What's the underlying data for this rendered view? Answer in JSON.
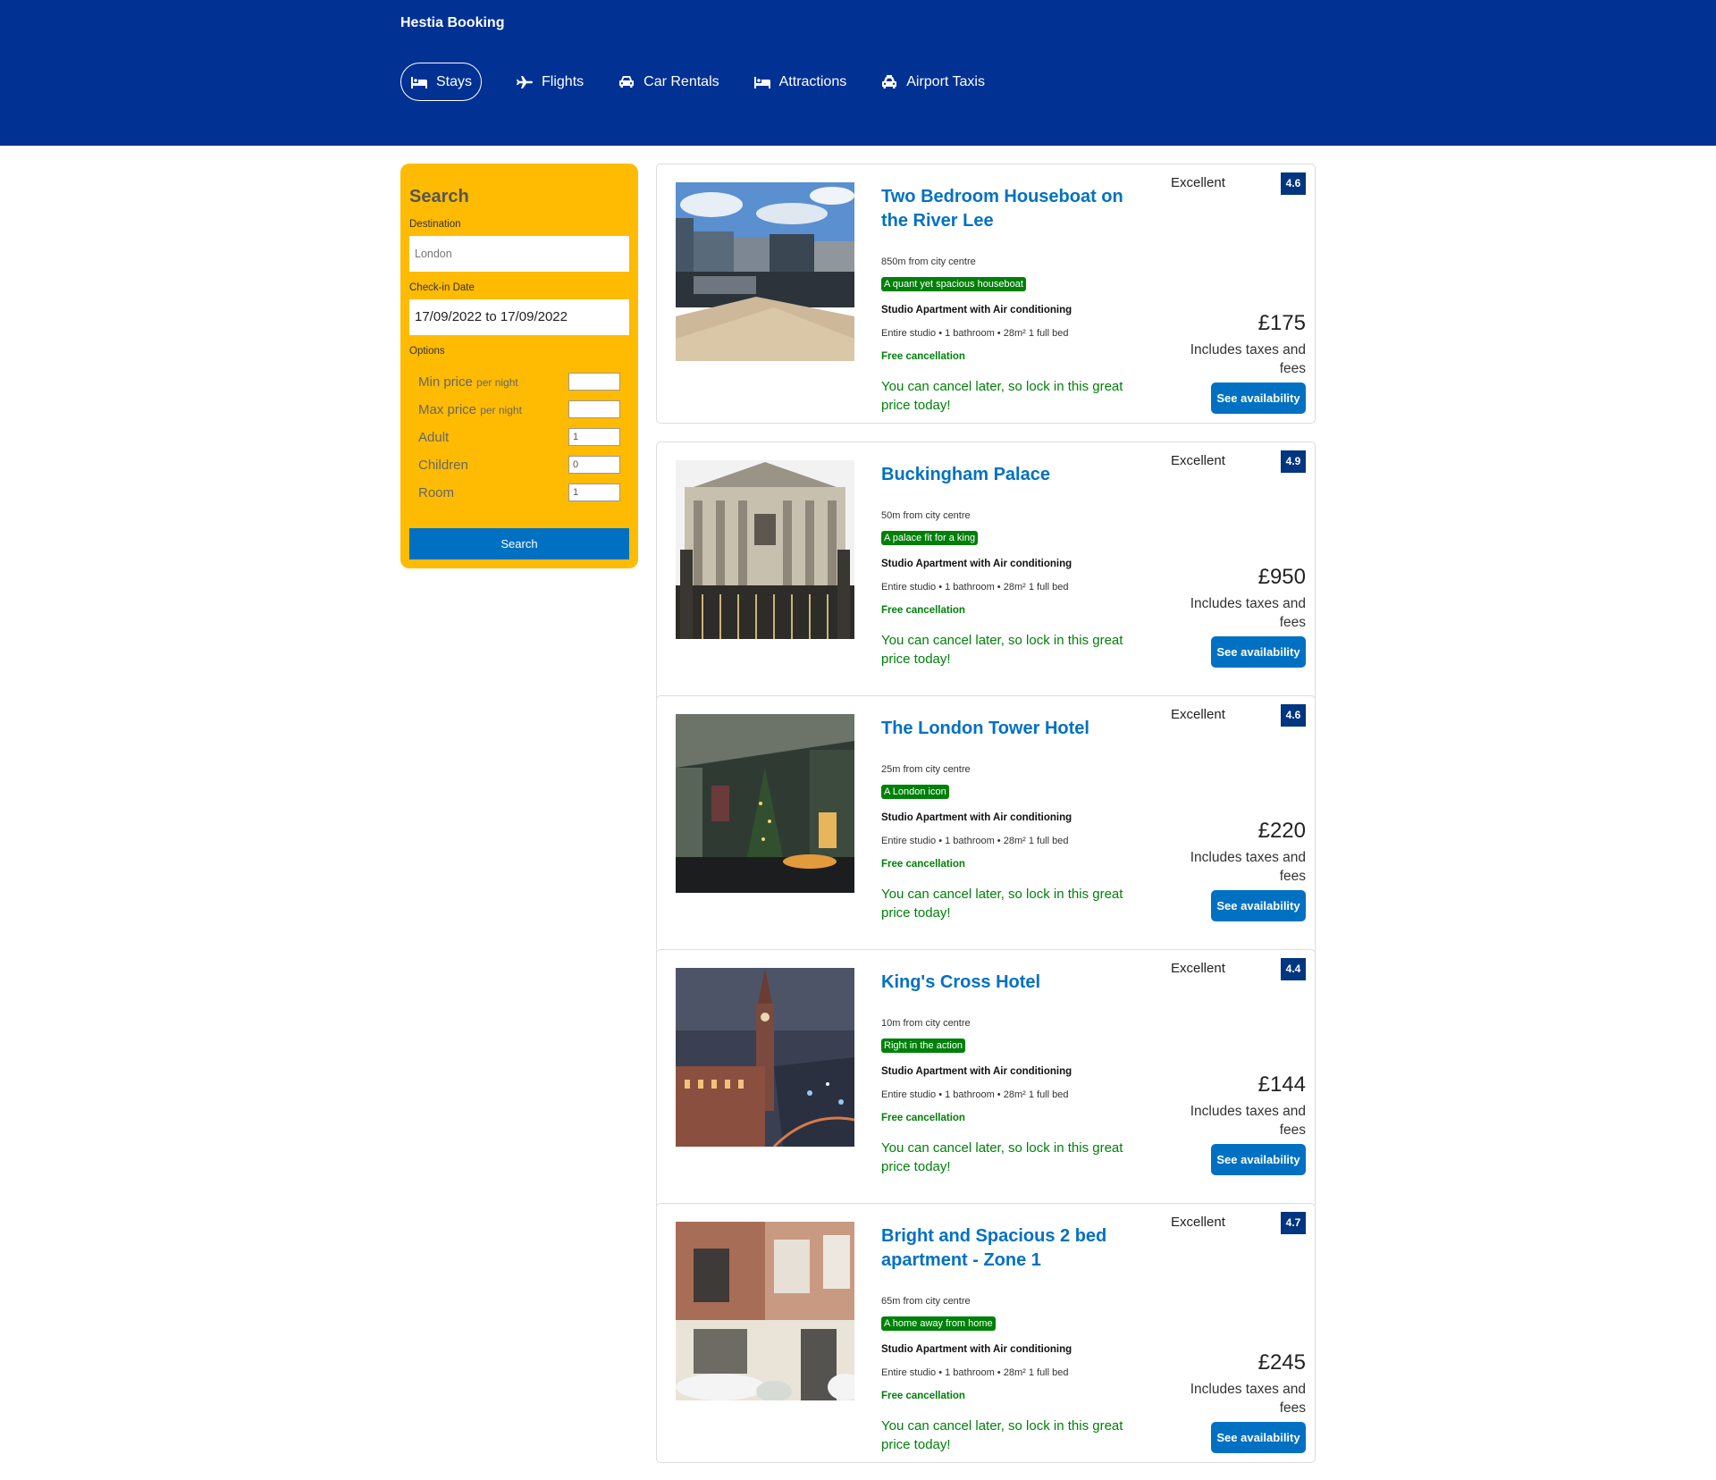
{
  "header": {
    "brand": "Hestia Booking",
    "nav": [
      {
        "label": "Stays",
        "icon": "bed-icon",
        "active": true
      },
      {
        "label": "Flights",
        "icon": "plane-icon"
      },
      {
        "label": "Car Rentals",
        "icon": "car-icon"
      },
      {
        "label": "Attractions",
        "icon": "bed-icon"
      },
      {
        "label": "Airport Taxis",
        "icon": "taxi-icon"
      }
    ]
  },
  "search": {
    "title": "Search",
    "destination_label": "Destination",
    "destination_placeholder": "London",
    "checkin_label": "Check-in Date",
    "checkin_value": "17/09/2022 to 17/09/2022",
    "options_label": "Options",
    "options": [
      {
        "label": "Min price",
        "suffix": "per night",
        "value": ""
      },
      {
        "label": "Max price",
        "suffix": "per night",
        "value": ""
      },
      {
        "label": "Adult",
        "suffix": "",
        "value": "1"
      },
      {
        "label": "Children",
        "suffix": "",
        "value": "0"
      },
      {
        "label": "Room",
        "suffix": "",
        "value": "1"
      }
    ],
    "button": "Search"
  },
  "results": [
    {
      "title": "Two Bedroom Houseboat on the River Lee",
      "distance": "850m from city centre",
      "taxi": "A quant yet spacious houseboat",
      "subtitle": "Studio Apartment with Air conditioning",
      "features": "Entire studio • 1 bathroom • 28m² 1 full bed",
      "cancel": "Free cancellation",
      "cancel_sub": "You can cancel later, so lock in this great price today!",
      "rating_text": "Excellent",
      "rating": "4.6",
      "price": "£175",
      "tax": "Includes taxes and fees",
      "button": "See availability"
    },
    {
      "title": "Buckingham Palace",
      "distance": "50m from city centre",
      "taxi": "A palace fit for a king",
      "subtitle": "Studio Apartment with Air conditioning",
      "features": "Entire studio • 1 bathroom • 28m² 1 full bed",
      "cancel": "Free cancellation",
      "cancel_sub": "You can cancel later, so lock in this great price today!",
      "rating_text": "Excellent",
      "rating": "4.9",
      "price": "£950",
      "tax": "Includes taxes and fees",
      "button": "See availability"
    },
    {
      "title": "The London Tower Hotel",
      "distance": "25m from city centre",
      "taxi": "A London icon",
      "subtitle": "Studio Apartment with Air conditioning",
      "features": "Entire studio • 1 bathroom • 28m² 1 full bed",
      "cancel": "Free cancellation",
      "cancel_sub": "You can cancel later, so lock in this great price today!",
      "rating_text": "Excellent",
      "rating": "4.6",
      "price": "£220",
      "tax": "Includes taxes and fees",
      "button": "See availability"
    },
    {
      "title": "King's Cross Hotel",
      "distance": "10m from city centre",
      "taxi": "Right in the action",
      "subtitle": "Studio Apartment with Air conditioning",
      "features": "Entire studio • 1 bathroom • 28m² 1 full bed",
      "cancel": "Free cancellation",
      "cancel_sub": "You can cancel later, so lock in this great price today!",
      "rating_text": "Excellent",
      "rating": "4.4",
      "price": "£144",
      "tax": "Includes taxes and fees",
      "button": "See availability"
    },
    {
      "title": "Bright and Spacious 2 bed apartment - Zone 1",
      "distance": "65m from city centre",
      "taxi": "A home away from home",
      "subtitle": "Studio Apartment with Air conditioning",
      "features": "Entire studio • 1 bathroom • 28m² 1 full bed",
      "cancel": "Free cancellation",
      "cancel_sub": "You can cancel later, so lock in this great price today!",
      "rating_text": "Excellent",
      "rating": "4.7",
      "price": "£245",
      "tax": "Includes taxes and fees",
      "button": "See availability"
    }
  ],
  "colors": {
    "header_bg": "#003193",
    "search_bg": "#febb02",
    "primary_button": "#0071c2",
    "rating_badge": "#003580",
    "green": "#008009"
  }
}
